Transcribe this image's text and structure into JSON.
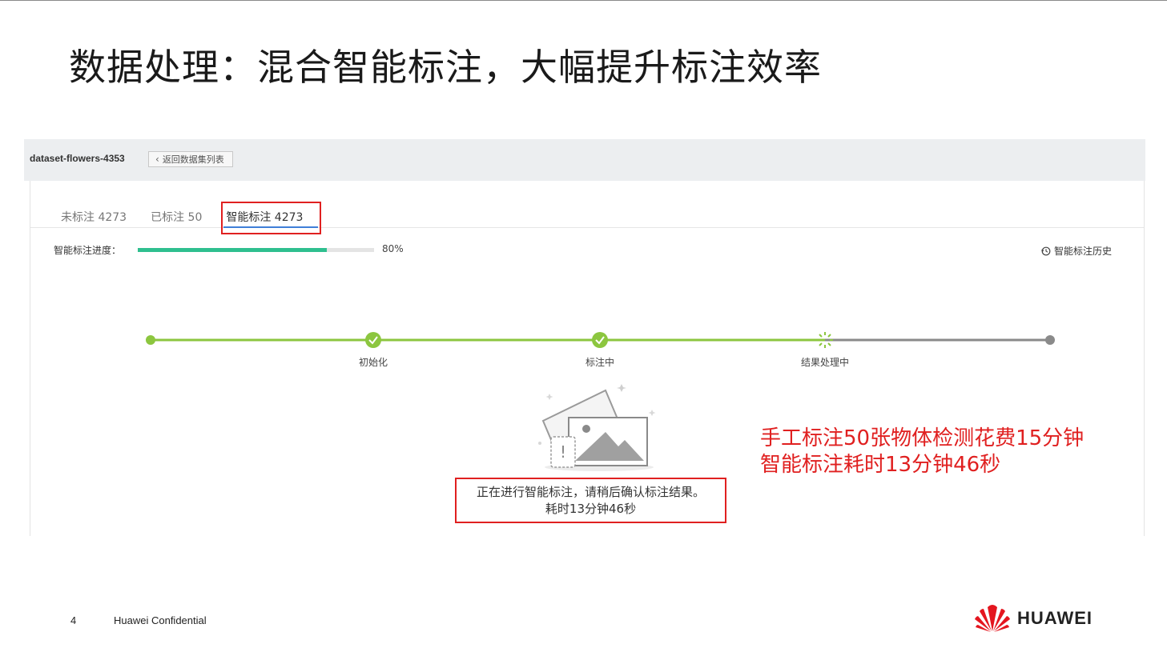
{
  "slide": {
    "title": "数据处理：混合智能标注，大幅提升标注效率",
    "page_number": "4",
    "confidential": "Huawei Confidential",
    "logo_text": "HUAWEI"
  },
  "panel": {
    "dataset_name": "dataset-flowers-4353",
    "back_button_label": "返回数据集列表",
    "tabs": [
      {
        "label": "未标注 4273",
        "active": false
      },
      {
        "label": "已标注 50",
        "active": false
      },
      {
        "label": "智能标注 4273",
        "active": true
      }
    ],
    "progress": {
      "label": "智能标注进度：",
      "value_text": "80%",
      "fraction": 0.8
    },
    "history_link": "智能标注历史",
    "steps": [
      {
        "label": "初始化",
        "state": "done"
      },
      {
        "label": "标注中",
        "state": "done"
      },
      {
        "label": "结果处理中",
        "state": "in-progress"
      }
    ],
    "status_line1": "正在进行智能标注，请稍后确认标注结果。",
    "status_line2": "耗时13分钟46秒"
  },
  "annotation": {
    "line1": "手工标注50张物体检测花费15分钟",
    "line2": "智能标注耗时13分钟46秒"
  },
  "colors": {
    "accent_red": "#e02020",
    "progress_green": "#2fbf8f",
    "step_green": "#8cc63f",
    "step_grey": "#8a8a8a",
    "tab_blue": "#3f7fd8",
    "huawei_red": "#e4161f"
  }
}
